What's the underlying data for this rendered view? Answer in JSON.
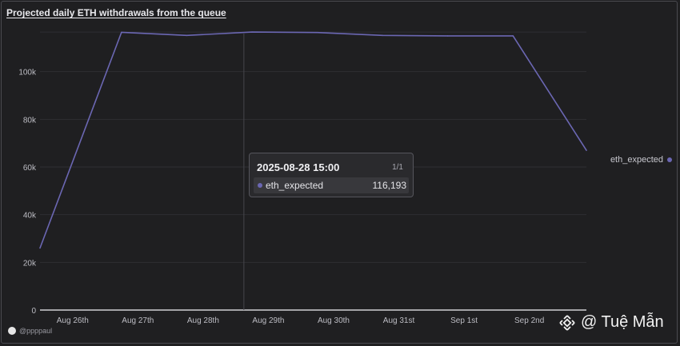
{
  "title": "Projected daily ETH withdrawals from the queue",
  "colors": {
    "series": "#6b67b3",
    "grid": "#2f2f33",
    "axis_text": "#bdbdc4",
    "background": "#1f1f21"
  },
  "chart_data": {
    "type": "line",
    "title": "Projected daily ETH withdrawals from the queue",
    "xlabel": "",
    "ylabel": "",
    "ylim": [
      0,
      120000
    ],
    "yticks": [
      0,
      20000,
      40000,
      60000,
      80000,
      100000
    ],
    "ytick_labels": [
      "0",
      "20k",
      "40k",
      "60k",
      "80k",
      "100k"
    ],
    "xtick_labels": [
      "Aug 26th",
      "Aug 27th",
      "Aug 28th",
      "Aug 29th",
      "Aug 30th",
      "Aug 31st",
      "Sep 1st",
      "Sep 2nd"
    ],
    "grid": true,
    "legend": "right",
    "series": [
      {
        "name": "eth_expected",
        "x": [
          "2025-08-25 12:00",
          "2025-08-26 18:00",
          "2025-08-27 18:00",
          "2025-08-28 18:00",
          "2025-08-29 18:00",
          "2025-08-30 18:00",
          "2025-08-31 18:00",
          "2025-09-01 18:00",
          "2025-09-02 21:00"
        ],
        "values": [
          26000,
          116500,
          115200,
          116600,
          116400,
          115200,
          115000,
          115000,
          67000
        ]
      }
    ]
  },
  "tooltip": {
    "time": "2025-08-28 15:00",
    "page": "1/1",
    "series_name": "eth_expected",
    "value": "116,193"
  },
  "author": "@ppppaul",
  "watermark": "@ Tuệ Mẫn"
}
